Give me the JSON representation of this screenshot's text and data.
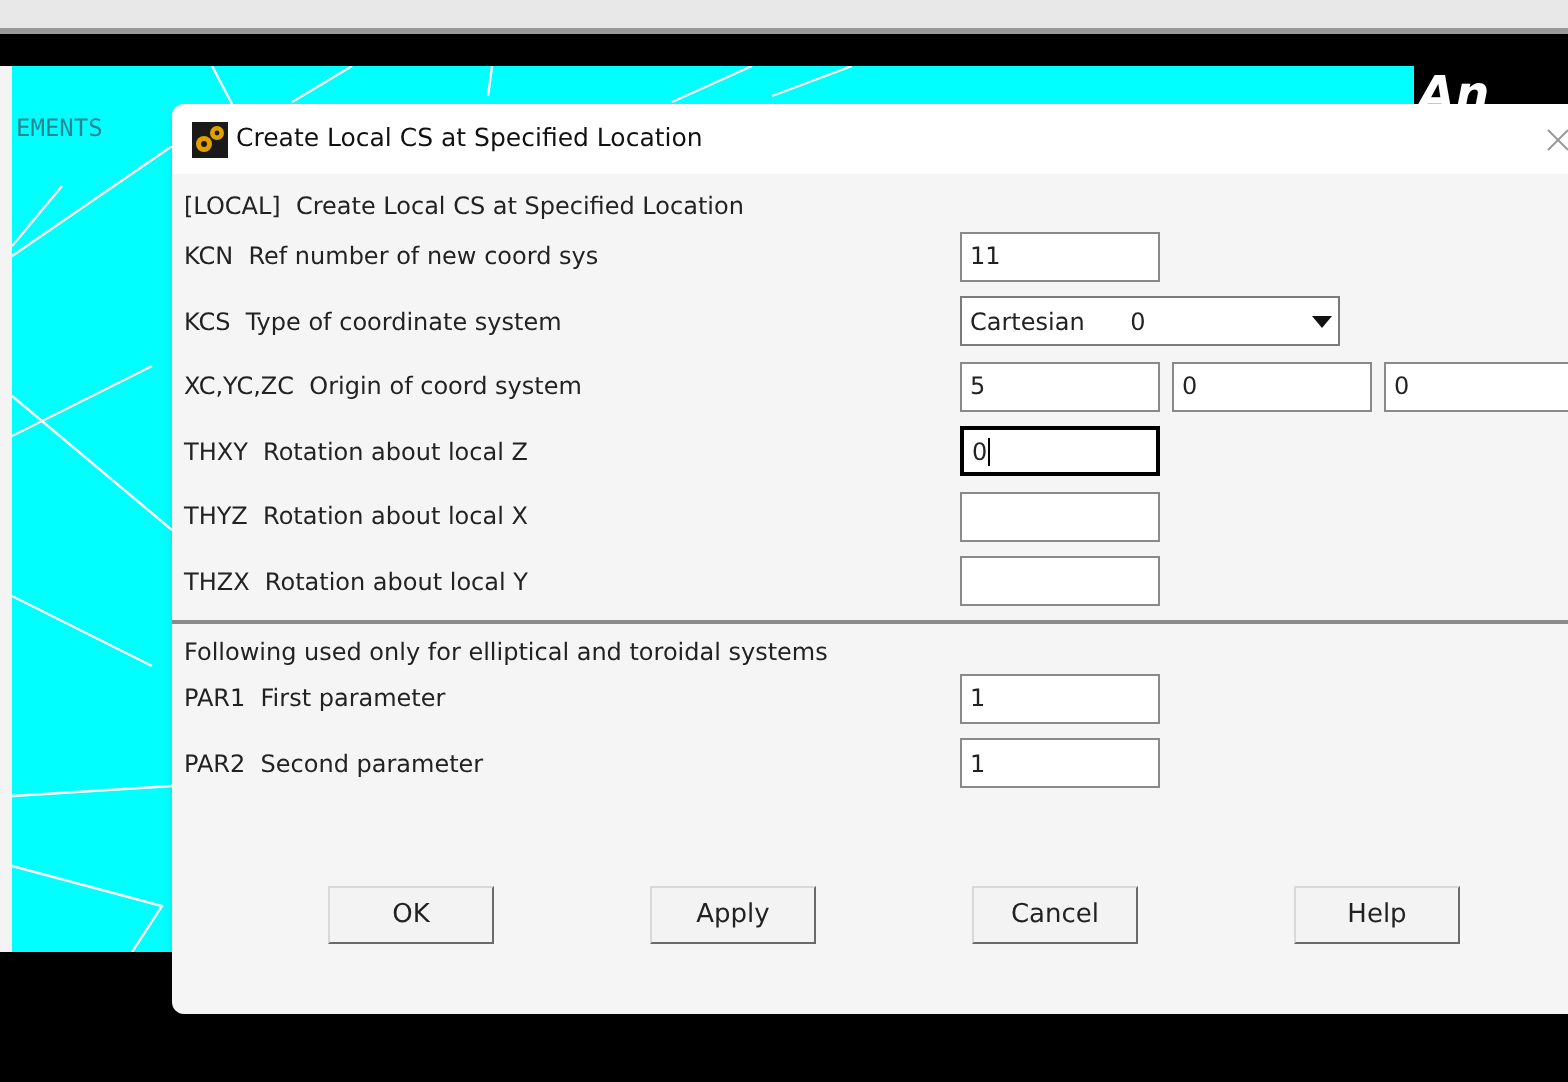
{
  "background": {
    "label": "EMENTS",
    "logo": "An"
  },
  "dialog": {
    "title": "Create Local CS at Specified Location",
    "heading": "[LOCAL]  Create Local CS at Specified Location",
    "fields": [
      {
        "kind": "text",
        "label": "KCN  Ref number of new coord sys",
        "values": [
          "11"
        ],
        "focused": false
      },
      {
        "kind": "select",
        "label": "KCS  Type of coordinate system",
        "values": [
          "Cartesian      0"
        ],
        "focused": false
      },
      {
        "kind": "text",
        "label": "XC,YC,ZC  Origin of coord system",
        "values": [
          "5",
          "0",
          "0"
        ],
        "focused": false
      },
      {
        "kind": "text",
        "label": "THXY  Rotation about local Z",
        "values": [
          "0"
        ],
        "focused": true
      },
      {
        "kind": "text",
        "label": "THYZ  Rotation about local X",
        "focused": false
      },
      {
        "kind": "text",
        "label": "THZX  Rotation about local Y",
        "focused": false
      }
    ],
    "note": "Following used only for elliptical and toroidal systems",
    "params": [
      {
        "kind": "text",
        "label": "PAR1  First parameter",
        "values": [
          "1"
        ],
        "focused": false
      },
      {
        "kind": "text",
        "label": "PAR2  Second parameter",
        "values": [
          "1"
        ],
        "focused": false
      }
    ],
    "buttons": [
      "OK",
      "Apply",
      "Cancel",
      "Help"
    ]
  }
}
